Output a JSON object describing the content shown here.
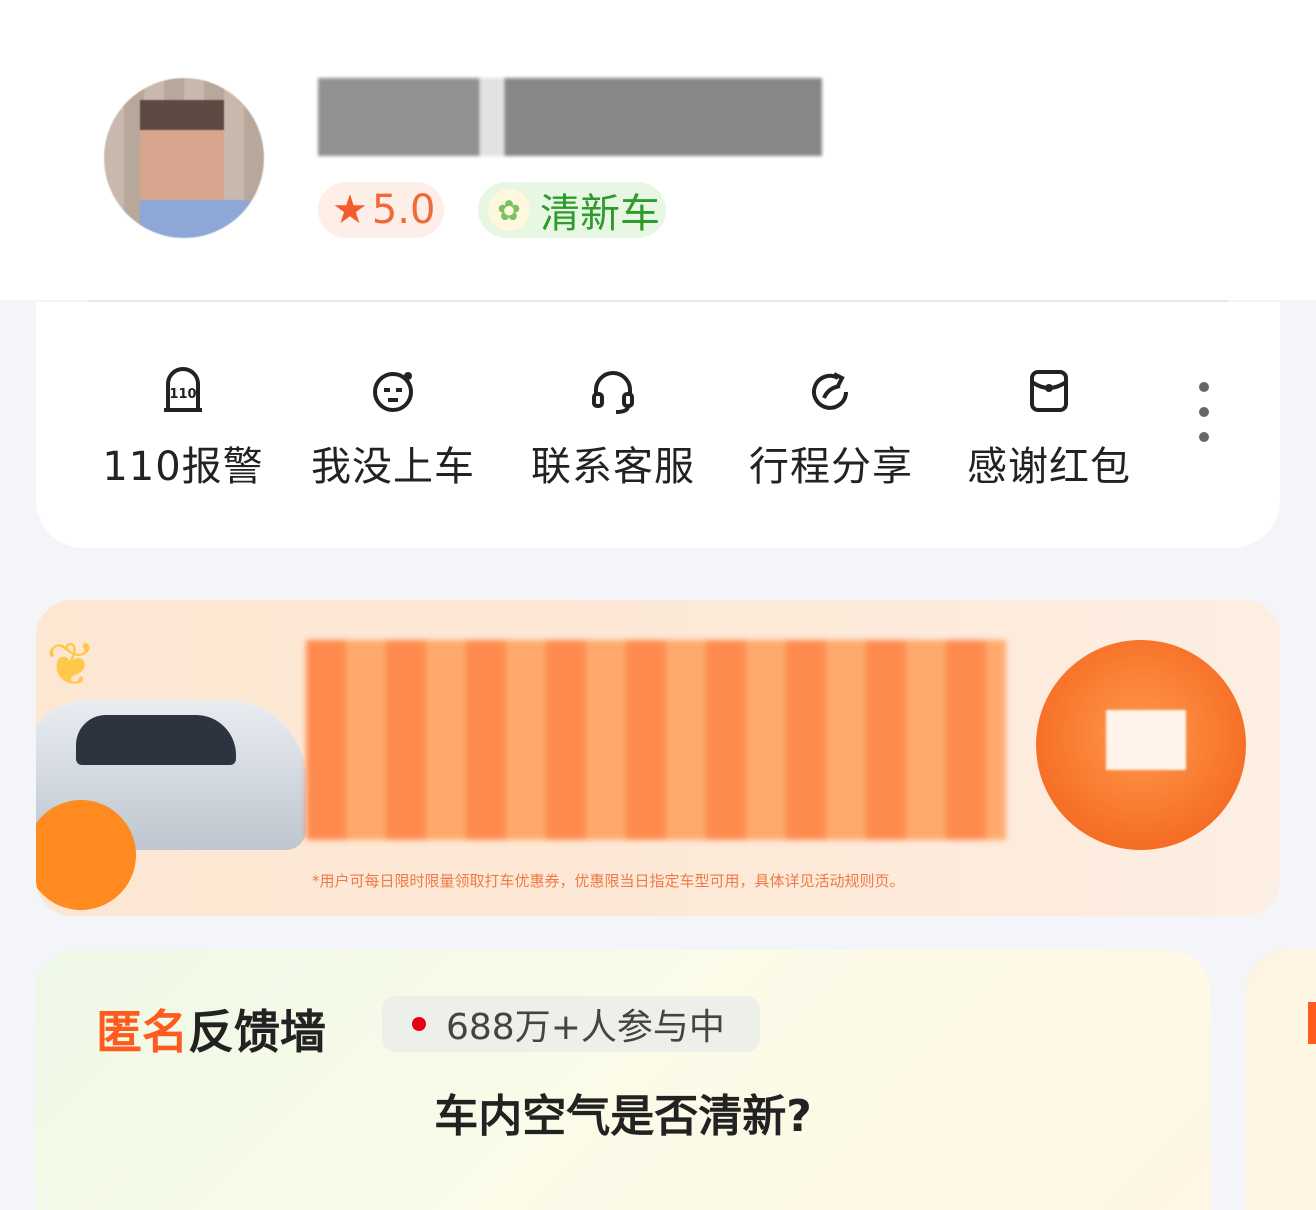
{
  "driver": {
    "rating": "5.0",
    "tag": "清新车"
  },
  "actions": [
    {
      "label": "110报警",
      "icon": "police-110-icon"
    },
    {
      "label": "我没上车",
      "icon": "face-icon"
    },
    {
      "label": "联系客服",
      "icon": "headset-icon"
    },
    {
      "label": "行程分享",
      "icon": "share-icon"
    },
    {
      "label": "感谢红包",
      "icon": "red-packet-icon"
    }
  ],
  "promo": {
    "footnote": "*用户可每日限时限量领取打车优惠券，优惠限当日指定车型可用，具体详见活动规则页。"
  },
  "feedback_wall": {
    "title_a": "匿名",
    "title_b": "反馈墙",
    "participants": "688万+人参与中",
    "question": "车内空气是否清新?"
  },
  "colors": {
    "accent_orange": "#ff5a1f",
    "fresh_green": "#2f9b2c",
    "rating_orange": "#f2683a"
  }
}
